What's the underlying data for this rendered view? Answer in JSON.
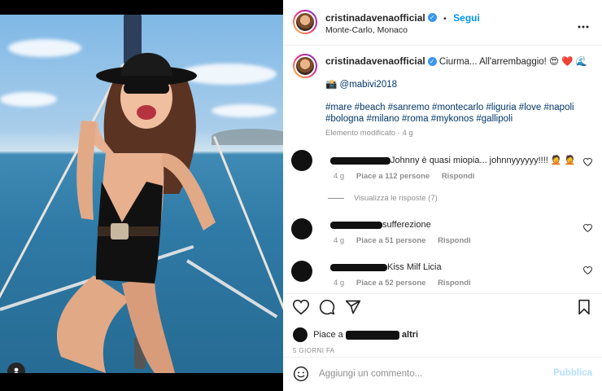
{
  "post": {
    "author": "cristinadavenaofficial",
    "follow_label": "Segui",
    "separator": "•",
    "location": "Monte-Carlo, Monaco",
    "more_label": "•••"
  },
  "caption": {
    "author": "cristinadavenaofficial",
    "text": "Ciurma... All'arrembaggio! 😍 ❤️ 🌊",
    "mention_prefix": "📸",
    "mention": "@mabivi2018",
    "hashtags_line1": "#mare #beach #sanremo #montecarlo #liguria #love #napoli",
    "hashtags_line2": "#bologna #milano #roma #mykonos #gallipoli",
    "edited": "Elemento modificato · 4 g"
  },
  "comments": [
    {
      "text": "Johnny è quasi miopia... johnnyyyyyy!!!! 🤦 🤦",
      "time": "4 g",
      "likes": "Piace a 112 persone",
      "reply": "Rispondi"
    },
    {
      "text": "sufferezione",
      "time": "4 g",
      "likes": "Piace a 51 persone",
      "reply": "Rispondi"
    },
    {
      "text": "Kiss Milf Licia",
      "time": "4 g",
      "likes": "Piace a 52 persone",
      "reply": "Rispondi"
    }
  ],
  "view_replies": "Visualizza le risposte (7)",
  "likes_prefix": "Piace a",
  "likes_suffix": "altri",
  "date": "5 GIORNI FA",
  "input": {
    "placeholder": "Aggiungi un commento..."
  },
  "publish_label": "Pubblica",
  "colors": {
    "accent": "#0095f6",
    "verified": "#3897f0",
    "link": "#00376b"
  },
  "icons": [
    "heart-icon",
    "comment-icon",
    "share-icon",
    "bookmark-icon",
    "emoji-icon",
    "user-tag-icon",
    "verified-icon"
  ]
}
